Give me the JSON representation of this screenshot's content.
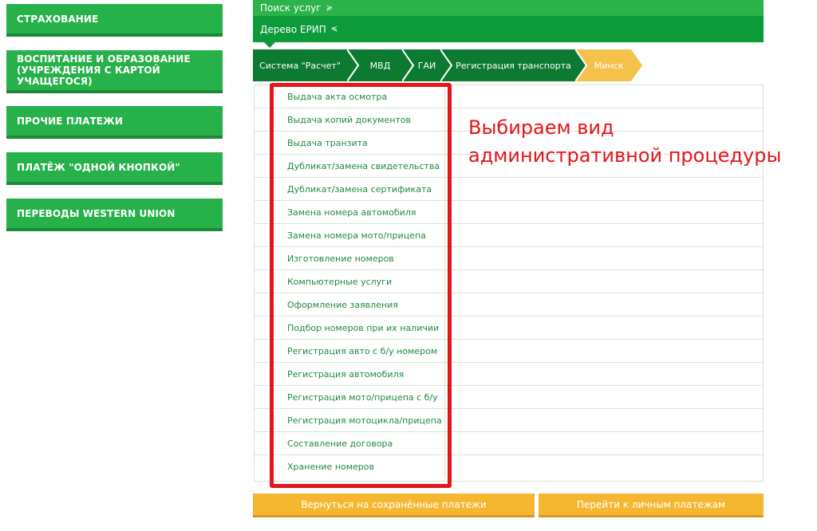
{
  "sidebar": {
    "items": [
      {
        "label": "Страхование"
      },
      {
        "label": "Воспитание и образование\n(учреждения с картой учащегося)"
      },
      {
        "label": "Прочие платежи"
      },
      {
        "label": "Платёж \"одной кнопкой\""
      },
      {
        "label": "Переводы Western Union"
      }
    ]
  },
  "top": {
    "search_label": "Поиск услуг",
    "search_chevron": "≽",
    "tree_label": "Дерево ЕРИП",
    "tree_chevron": "≼"
  },
  "breadcrumbs": [
    {
      "label": "Система \"Расчет\""
    },
    {
      "label": "МВД"
    },
    {
      "label": "ГАИ"
    },
    {
      "label": "Регистрация транспорта"
    },
    {
      "label": "Минск"
    }
  ],
  "colors": {
    "crumb": "#0d7a32",
    "crumb_active": "#f4c24a",
    "accent_green": "#27b14a",
    "highlight": "#e4161c"
  },
  "procedures": [
    "Выдача акта осмотра",
    "Выдача копий документов",
    "Выдача транзита",
    "Дубликат/замена свидетельства",
    "Дубликат/замена сертификата",
    "Замена номера автомобиля",
    "Замена номера мото/прицепа",
    "Изготовление номеров",
    "Компьютерные услуги",
    "Оформление заявления",
    "Подбор номеров при их наличии",
    "Регистрация авто с б/у номером",
    "Регистрация автомобиля",
    "Регистрация мото/прицепа с б/у",
    "Регистрация мотоцикла/прицепа",
    "Составление договора",
    "Хранение номеров"
  ],
  "annotation": {
    "line1": "Выбираем вид",
    "line2": "административной процедуры"
  },
  "buttons": {
    "saved": "Вернуться на сохранённые платежи",
    "personal": "Перейти к личным платежам"
  }
}
